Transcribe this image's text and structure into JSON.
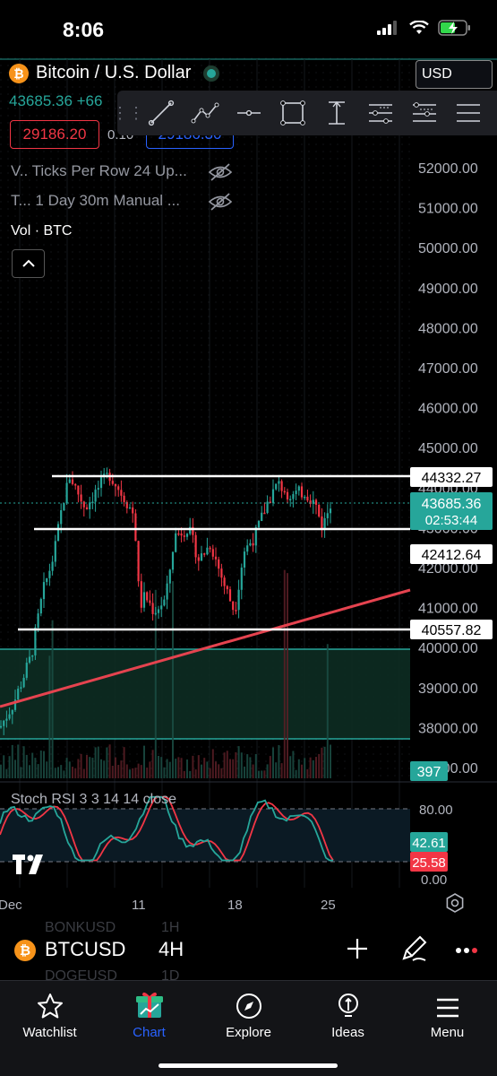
{
  "status_bar": {
    "time": "8:06"
  },
  "header": {
    "symbol_title": "Bitcoin / U.S. Dollar",
    "price_line": "43685.36 +66",
    "sell_price": "29186.20",
    "spread": "0.10",
    "buy_price": "29186.30",
    "currency": "USD"
  },
  "indicators": {
    "row1": "V.. Ticks Per Row 24 Up...",
    "row2": "T... 1 Day 30m Manual ...",
    "vol_label": "Vol · BTC"
  },
  "drawing_tools": [
    "trend-line",
    "polyline",
    "horizontal-line",
    "rectangle",
    "vertical-measure",
    "fib-retracement",
    "pitchfork",
    "parallel-channel"
  ],
  "price_axis": {
    "ticks": [
      "52000.00",
      "51000.00",
      "50000.00",
      "49000.00",
      "48000.00",
      "47000.00",
      "46000.00",
      "45000.00",
      "44000.00",
      "43000.00",
      "42000.00",
      "41000.00",
      "40000.00",
      "39000.00",
      "38000.00",
      "37000.00"
    ],
    "h_lines": [
      "44332.27",
      "42412.64",
      "40557.82"
    ],
    "current_price": "43685.36",
    "countdown": "02:53:44",
    "volume_badge": "397"
  },
  "stoch_rsi": {
    "label": "Stoch RSI 3 3 14 14 close",
    "ticks": [
      "80.00",
      "0.00"
    ],
    "k_value": "42.61",
    "d_value": "25.58"
  },
  "time_axis": {
    "labels": [
      "Dec",
      "11",
      "18",
      "25"
    ]
  },
  "symbol_bar": {
    "symbol": "BTCUSD",
    "interval": "4H",
    "ghost_top_symbol": "BONKUSD",
    "ghost_top_interval": "1H",
    "ghost_bottom_symbol": "DOGEUSD",
    "ghost_bottom_interval": "1D"
  },
  "tabs": [
    {
      "label": "Watchlist",
      "icon": "star-icon"
    },
    {
      "label": "Chart",
      "icon": "chart-gift-icon",
      "active": true
    },
    {
      "label": "Explore",
      "icon": "compass-icon"
    },
    {
      "label": "Ideas",
      "icon": "lightbulb-icon"
    },
    {
      "label": "Menu",
      "icon": "hamburger-icon"
    }
  ],
  "colors": {
    "up": "#26a69a",
    "down": "#f23645",
    "accent": "#2962ff",
    "trendline": "#e5434f",
    "bitcoin": "#f7931a"
  }
}
